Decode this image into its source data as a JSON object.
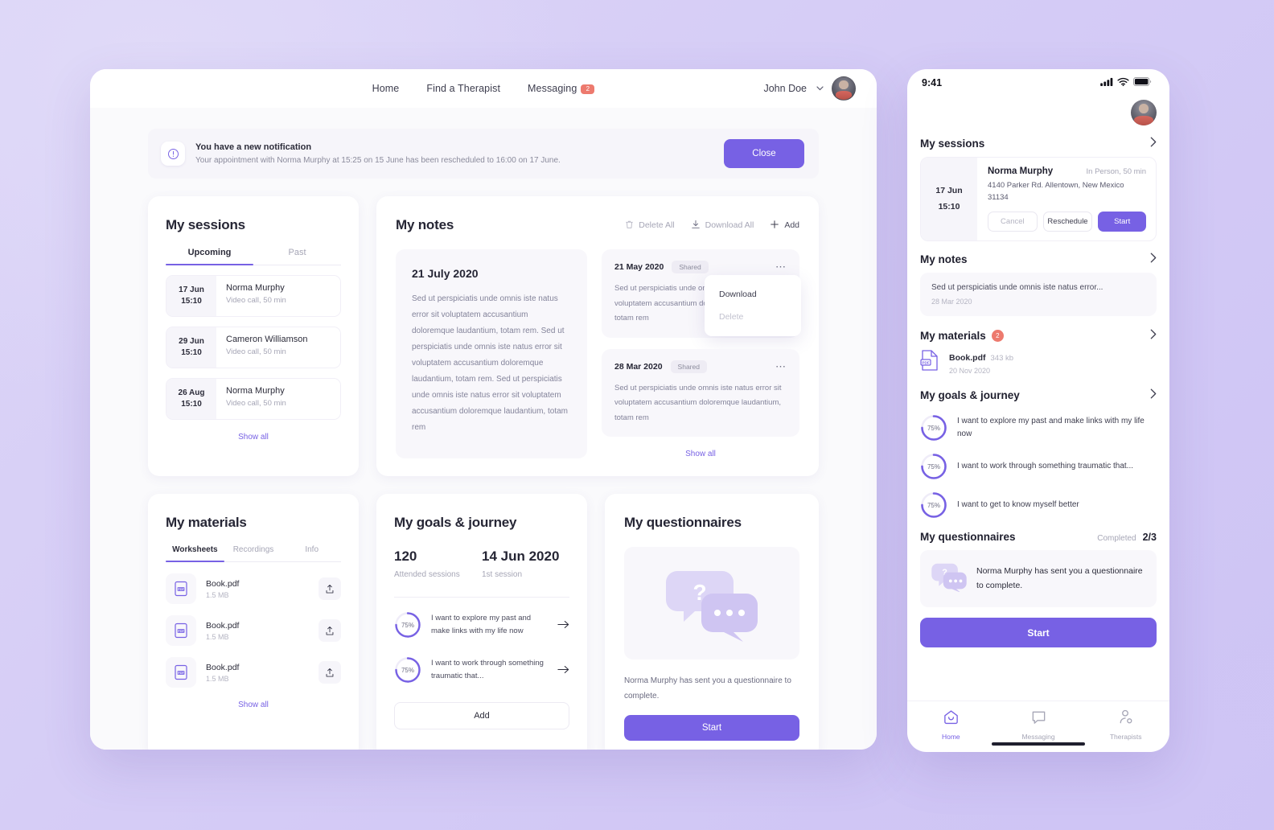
{
  "desktop": {
    "nav": {
      "links": [
        {
          "label": "Home",
          "badge": null
        },
        {
          "label": "Find a Therapist",
          "badge": null
        },
        {
          "label": "Messaging",
          "badge": "2"
        }
      ],
      "user_name": "John Doe",
      "chevron": "⌄"
    },
    "notification": {
      "title": "You have a new notification",
      "message": "Your appointment with Norma Murphy at 15:25 on 15 June has been rescheduled to 16:00 on 17 June.",
      "close_label": "Close"
    },
    "sessions": {
      "title": "My sessions",
      "tabs": [
        {
          "label": "Upcoming",
          "active": true
        },
        {
          "label": "Past",
          "active": false
        }
      ],
      "rows": [
        {
          "date": "17 Jun",
          "time": "15:10",
          "name": "Norma Murphy",
          "meta": "Video call, 50 min"
        },
        {
          "date": "29 Jun",
          "time": "15:10",
          "name": "Cameron Williamson",
          "meta": "Video call, 50 min"
        },
        {
          "date": "26 Aug",
          "time": "15:10",
          "name": "Norma Murphy",
          "meta": "Video call, 50 min"
        }
      ],
      "show_all": "Show all"
    },
    "notes": {
      "title": "My notes",
      "actions": [
        {
          "label": "Delete All",
          "icon": "trash-icon"
        },
        {
          "label": "Download All",
          "icon": "download-icon"
        },
        {
          "label": "Add",
          "icon": "plus-icon"
        }
      ],
      "featured": {
        "date": "21 July 2020",
        "text": "Sed ut perspiciatis unde omnis iste natus error sit voluptatem accusantium doloremque laudantium, totam rem. Sed ut perspiciatis unde omnis iste natus error sit voluptatem accusantium doloremque laudantium, totam rem. Sed ut perspiciatis unde omnis iste natus error sit voluptatem accusantium doloremque laudantium, totam rem"
      },
      "items": [
        {
          "date": "21 May 2020",
          "chip": "Shared",
          "text": "Sed ut perspiciatis unde omnis iste natus error sit voluptatem accusantium doloremque laudantium, totam rem",
          "menu": [
            {
              "label": "Download",
              "state": "enabled"
            },
            {
              "label": "Delete",
              "state": "disabled"
            }
          ]
        },
        {
          "date": "28 Mar 2020",
          "chip": "Shared",
          "text": "Sed ut perspiciatis unde omnis iste natus error sit voluptatem accusantium doloremque laudantium, totam rem"
        }
      ],
      "show_all": "Show all"
    },
    "materials": {
      "title": "My materials",
      "tabs": [
        {
          "label": "Worksheets",
          "active": true
        },
        {
          "label": "Recordings",
          "active": false
        },
        {
          "label": "Info",
          "active": false
        }
      ],
      "rows": [
        {
          "name": "Book.pdf",
          "size": "1.5 MB"
        },
        {
          "name": "Book.pdf",
          "size": "1.5 MB"
        },
        {
          "name": "Book.pdf",
          "size": "1.5 MB"
        }
      ],
      "show_all": "Show all"
    },
    "goals": {
      "title": "My goals & journey",
      "stats": [
        {
          "value": "120",
          "label": "Attended sessions"
        },
        {
          "value": "14 Jun 2020",
          "label": "1st session"
        }
      ],
      "items": [
        {
          "percent": "75%",
          "progress": 75,
          "text": "I want to explore my past and make links with my life now"
        },
        {
          "percent": "75%",
          "progress": 75,
          "text": "I want to work through something traumatic that..."
        }
      ],
      "add_label": "Add"
    },
    "questionnaires": {
      "title": "My questionnaires",
      "text": "Norma Murphy has sent you a questionnaire to complete.",
      "start_label": "Start"
    }
  },
  "mobile": {
    "statusbar": {
      "time": "9:41"
    },
    "sessions": {
      "title": "My sessions",
      "session": {
        "date": "17 Jun",
        "time": "15:10",
        "name": "Norma Murphy",
        "type": "In Person, 50 min",
        "address": "4140 Parker Rd. Allentown, New Mexico 31134",
        "buttons": [
          {
            "label": "Cancel",
            "style": "cancel"
          },
          {
            "label": "Reschedule",
            "style": "resched"
          },
          {
            "label": "Start",
            "style": "start"
          }
        ]
      }
    },
    "notes": {
      "title": "My notes",
      "item": {
        "text": "Sed ut perspiciatis unde omnis iste natus error...",
        "date": "28 Mar 2020"
      }
    },
    "materials": {
      "title": "My materials",
      "badge": "2",
      "item": {
        "name": "Book.pdf",
        "size": "343 kb",
        "date": "20 Nov 2020"
      }
    },
    "goals": {
      "title": "My goals & journey",
      "items": [
        {
          "percent": "75%",
          "progress": 75,
          "text": "I want to explore my past and make links with my life now"
        },
        {
          "percent": "75%",
          "progress": 75,
          "text": "I want to work through something traumatic that..."
        },
        {
          "percent": "75%",
          "progress": 75,
          "text": "I want to get to know myself better"
        }
      ]
    },
    "questionnaires": {
      "title": "My questionnaires",
      "completed_label": "Completed",
      "completed_value": "2/3",
      "text": "Norma Murphy has sent you a questionnaire to complete.",
      "start_label": "Start"
    },
    "tabbar": [
      {
        "label": "Home",
        "icon": "home-icon",
        "active": true
      },
      {
        "label": "Messaging",
        "icon": "message-icon",
        "active": false
      },
      {
        "label": "Therapists",
        "icon": "therapists-icon",
        "active": false
      }
    ]
  },
  "colors": {
    "accent": "#7761e4",
    "badge": "#ed7a6e",
    "page_bg": "#d5ccf6",
    "card_bg": "#ffffff",
    "muted_bg": "#f8f7fb"
  }
}
